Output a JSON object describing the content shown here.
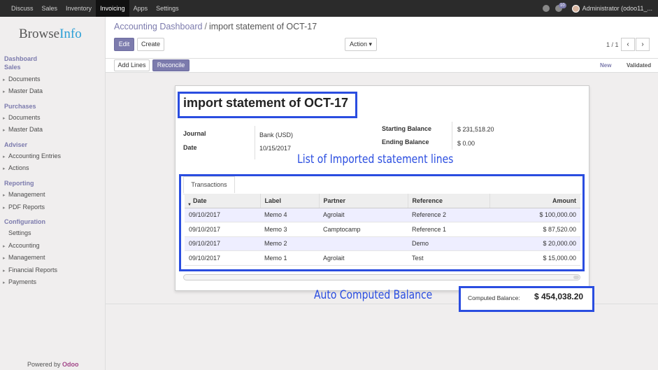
{
  "topbar": {
    "menu": [
      "Discuss",
      "Sales",
      "Inventory",
      "Invoicing",
      "Apps",
      "Settings"
    ],
    "active": "Invoicing",
    "messages_count": "10",
    "user": "Administrator (odoo11_..."
  },
  "sidebar": {
    "logo_part1": "Browse",
    "logo_part2": "Info",
    "sections": [
      {
        "heading": "Dashboard"
      },
      {
        "heading": "Sales",
        "items": [
          "Documents",
          "Master Data"
        ]
      },
      {
        "heading": "Purchases",
        "items": [
          "Documents",
          "Master Data"
        ]
      },
      {
        "heading": "Adviser",
        "items": [
          "Accounting Entries",
          "Actions"
        ]
      },
      {
        "heading": "Reporting",
        "items": [
          "Management",
          "PDF Reports"
        ]
      },
      {
        "heading": "Configuration",
        "items": [
          "Settings",
          "Accounting",
          "Management",
          "Financial Reports",
          "Payments"
        ]
      }
    ],
    "powered_by": "Powered by",
    "powered_brand": "Odoo"
  },
  "control": {
    "breadcrumb_parent": "Accounting Dashboard",
    "breadcrumb_sep": "/",
    "breadcrumb_current": "import statement of OCT-17",
    "edit_label": "Edit",
    "create_label": "Create",
    "action_label": "Action ▾",
    "pager": "1 / 1",
    "prev_icon": "‹",
    "next_icon": "›"
  },
  "statusbar": {
    "add_lines_label": "Add Lines",
    "reconcile_label": "Reconcile",
    "stages": [
      "New",
      "Validated"
    ],
    "active_stage": "New"
  },
  "form": {
    "title": "import statement of OCT-17",
    "journal_label": "Journal",
    "journal_value": "Bank (USD)",
    "date_label": "Date",
    "date_value": "10/15/2017",
    "starting_balance_label": "Starting Balance",
    "starting_balance_value": "$ 231,518.20",
    "ending_balance_label": "Ending Balance",
    "ending_balance_value": "$ 0.00",
    "tab_label": "Transactions",
    "columns": [
      "Date",
      "Label",
      "Partner",
      "Reference",
      "Amount"
    ],
    "rows": [
      [
        "09/10/2017",
        "Memo 4",
        "Agrolait",
        "Reference 2",
        "$ 100,000.00"
      ],
      [
        "09/10/2017",
        "Memo 3",
        "Camptocamp",
        "Reference 1",
        "$ 87,520.00"
      ],
      [
        "09/10/2017",
        "Memo 2",
        "",
        "Demo",
        "$ 20,000.00"
      ],
      [
        "09/10/2017",
        "Memo 1",
        "Agrolait",
        "Test",
        "$ 15,000.00"
      ]
    ],
    "computed_balance_label": "Computed Balance:",
    "computed_balance_value": "$ 454,038.20"
  },
  "annotations": {
    "list_caption": "List of Imported statement lines",
    "balance_caption": "Auto Computed Balance",
    "highlight_color": "#2a4de0"
  },
  "colors": {
    "accent": "#7c7bad",
    "topbar": "#2b2b2b",
    "brand_odoo": "#a24689"
  }
}
